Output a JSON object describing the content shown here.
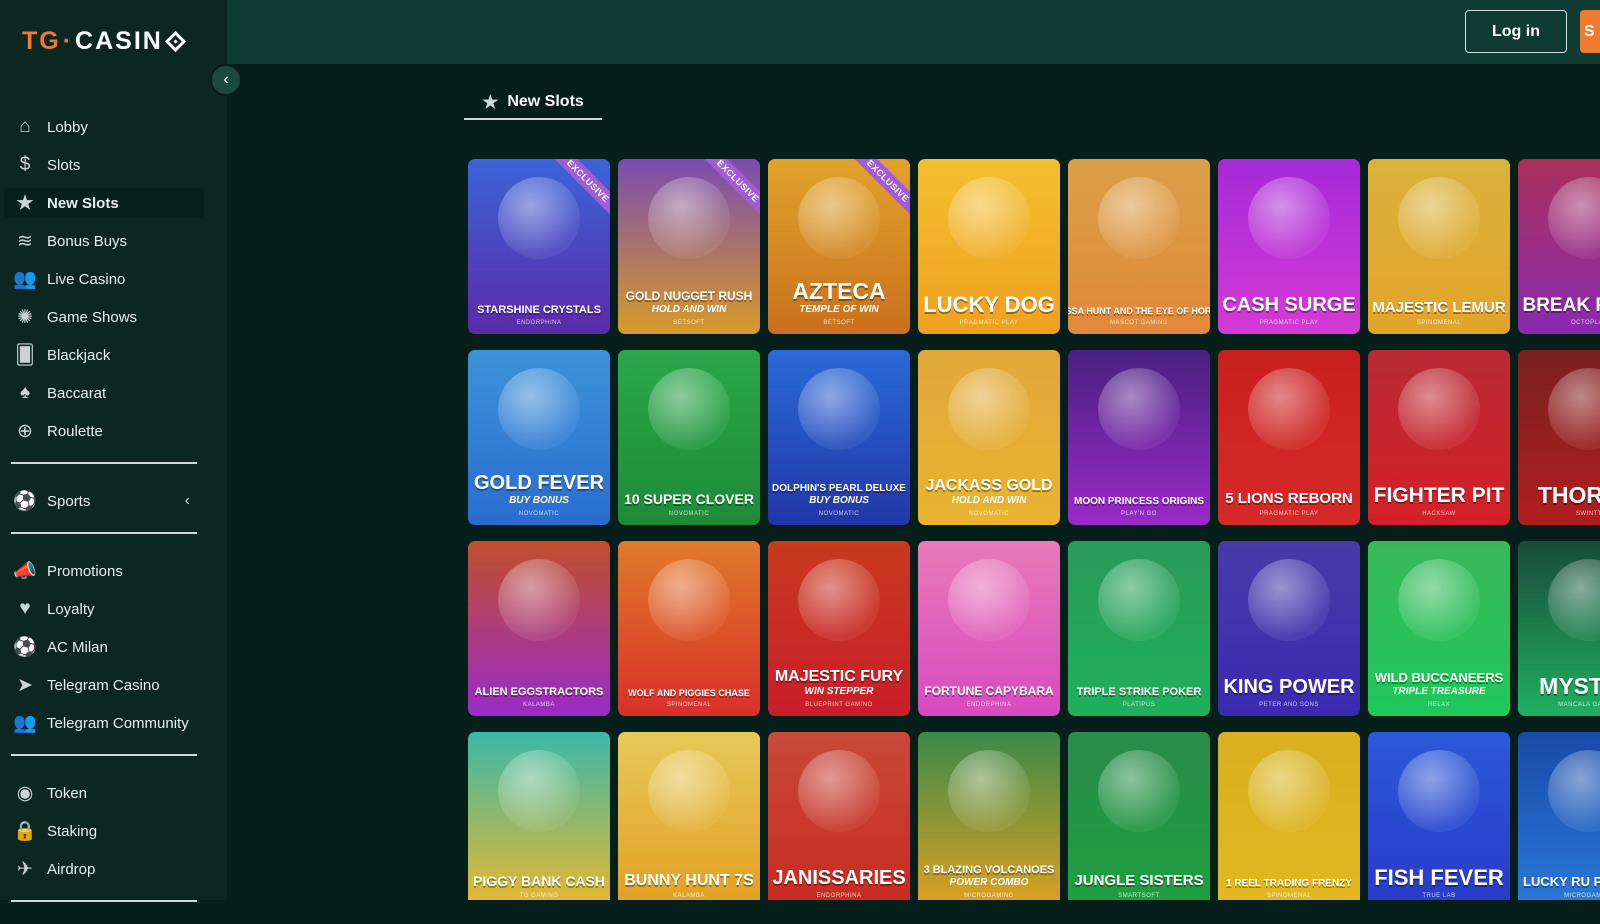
{
  "logo": {
    "tg": "TG",
    "dot": "·",
    "casino": "CASIN"
  },
  "header": {
    "login": "Log in",
    "signup": "S"
  },
  "sidebar": {
    "group1": [
      {
        "label": "Lobby",
        "icon": "home-icon",
        "glyph": "⌂"
      },
      {
        "label": "Slots",
        "icon": "dollar-coin-icon",
        "glyph": "$"
      },
      {
        "label": "New Slots",
        "icon": "star-icon",
        "glyph": "★",
        "active": true
      },
      {
        "label": "Bonus Buys",
        "icon": "coin-stack-icon",
        "glyph": "≋"
      },
      {
        "label": "Live Casino",
        "icon": "users-icon",
        "glyph": "👥"
      },
      {
        "label": "Game Shows",
        "icon": "wheel-icon",
        "glyph": "✺"
      },
      {
        "label": "Blackjack",
        "icon": "cards-icon",
        "glyph": "🂠"
      },
      {
        "label": "Baccarat",
        "icon": "spade-icon",
        "glyph": "♠"
      },
      {
        "label": "Roulette",
        "icon": "roulette-icon",
        "glyph": "⊕"
      }
    ],
    "sports": {
      "label": "Sports",
      "icon": "soccer-ball-icon",
      "glyph": "⚽"
    },
    "group2": [
      {
        "label": "Promotions",
        "icon": "megaphone-icon",
        "glyph": "📣"
      },
      {
        "label": "Loyalty",
        "icon": "heart-hand-icon",
        "glyph": "♥"
      },
      {
        "label": "AC Milan",
        "icon": "football-icon",
        "glyph": "⚽"
      },
      {
        "label": "Telegram Casino",
        "icon": "telegram-icon",
        "glyph": "➤"
      },
      {
        "label": "Telegram Community",
        "icon": "community-icon",
        "glyph": "👥"
      }
    ],
    "group3": [
      {
        "label": "Token",
        "icon": "token-icon",
        "glyph": "◉"
      },
      {
        "label": "Staking",
        "icon": "lock-icon",
        "glyph": "🔒"
      },
      {
        "label": "Airdrop",
        "icon": "plane-icon",
        "glyph": "✈"
      }
    ]
  },
  "tab": {
    "label": "New Slots"
  },
  "badge": "EXCLUSIVE",
  "games": [
    [
      {
        "title": "STARSHINE CRYSTALS",
        "sub": "",
        "provider": "ENDORPHINA",
        "bg": [
          "#3b64d8",
          "#5b2aa8"
        ],
        "exclusive": true
      },
      {
        "title": "GOLD NUGGET RUSH",
        "sub": "HOLD AND WIN",
        "provider": "BETSOFT",
        "bg": [
          "#7a4bb0",
          "#d79a2a"
        ],
        "exclusive": true
      },
      {
        "title": "AZTECA",
        "sub": "TEMPLE OF WIN",
        "provider": "BETSOFT",
        "bg": [
          "#e0a32a",
          "#c9701d"
        ],
        "exclusive": true
      },
      {
        "title": "LUCKY DOG",
        "sub": "",
        "provider": "PRAGMATIC PLAY",
        "bg": [
          "#f2c030",
          "#f0a020"
        ],
        "exclusive": false
      },
      {
        "title": "TESSA HUNT AND THE EYE OF HORUS",
        "sub": "",
        "provider": "MASCOT GAMING",
        "bg": [
          "#d9a048",
          "#e2883a"
        ],
        "exclusive": false
      },
      {
        "title": "CASH SURGE",
        "sub": "",
        "provider": "PRAGMATIC PLAY",
        "bg": [
          "#a52ad8",
          "#d43ad4"
        ],
        "exclusive": false
      },
      {
        "title": "MAJESTIC LEMUR",
        "sub": "",
        "provider": "SPINOMENAL",
        "bg": [
          "#d9b23a",
          "#e3a42a"
        ],
        "exclusive": false
      },
      {
        "title": "BREAK PIGGY",
        "sub": "",
        "provider": "OCTOPLAY",
        "bg": [
          "#a8305a",
          "#8a2ab0"
        ],
        "exclusive": false
      }
    ],
    [
      {
        "title": "GOLD FEVER",
        "sub": "BUY BONUS",
        "provider": "NOVOMATIC",
        "bg": [
          "#3c93d8",
          "#2a6cd0"
        ],
        "exclusive": false
      },
      {
        "title": "10 SUPER CLOVER",
        "sub": "",
        "provider": "NOVOMATIC",
        "bg": [
          "#2aa84a",
          "#1e8a38"
        ],
        "exclusive": false
      },
      {
        "title": "DOLPHIN'S PEARL DELUXE",
        "sub": "BUY BONUS",
        "provider": "NOVOMATIC",
        "bg": [
          "#2a6ad8",
          "#2236a8"
        ],
        "exclusive": false
      },
      {
        "title": "JACKASS GOLD",
        "sub": "HOLD AND WIN",
        "provider": "NOVOMATIC",
        "bg": [
          "#e0a83a",
          "#e8b430"
        ],
        "exclusive": false
      },
      {
        "title": "MOON PRINCESS ORIGINS",
        "sub": "",
        "provider": "PLAY'N GO",
        "bg": [
          "#4a2080",
          "#9a2ac8"
        ],
        "exclusive": false
      },
      {
        "title": "5 LIONS REBORN",
        "sub": "",
        "provider": "PRAGMATIC PLAY",
        "bg": [
          "#c8201e",
          "#d62a2a"
        ],
        "exclusive": false
      },
      {
        "title": "FIGHTER PIT",
        "sub": "",
        "provider": "HACKSAW",
        "bg": [
          "#b82a34",
          "#d42028"
        ],
        "exclusive": false
      },
      {
        "title": "THOR VS",
        "sub": "",
        "provider": "SWINTT",
        "bg": [
          "#7a2020",
          "#b01e1e"
        ],
        "exclusive": false
      }
    ],
    [
      {
        "title": "ALIEN EGGSTRACTORS",
        "sub": "",
        "provider": "KALAMBA",
        "bg": [
          "#c0502a",
          "#9a2ac8"
        ],
        "exclusive": false
      },
      {
        "title": "WOLF AND PIGGIES CHASE",
        "sub": "",
        "provider": "SPINOMENAL",
        "bg": [
          "#e07a2a",
          "#d8302a"
        ],
        "exclusive": false
      },
      {
        "title": "MAJESTIC FURY",
        "sub": "WIN STEPPER",
        "provider": "BLUEPRINT GAMING",
        "bg": [
          "#c83a1e",
          "#c81e2a"
        ],
        "exclusive": false
      },
      {
        "title": "FORTUNE CAPYBARA",
        "sub": "",
        "provider": "ENDORPHINA",
        "bg": [
          "#e87ab8",
          "#d84ac0"
        ],
        "exclusive": false
      },
      {
        "title": "TRIPLE STRIKE POKER",
        "sub": "",
        "provider": "PLATIPUS",
        "bg": [
          "#2a9a5a",
          "#1eb05a"
        ],
        "exclusive": false
      },
      {
        "title": "KING POWER",
        "sub": "",
        "provider": "PETER AND SONS",
        "bg": [
          "#4a3aa8",
          "#3a2ab0"
        ],
        "exclusive": false
      },
      {
        "title": "WILD BUCCANEERS",
        "sub": "TRIPLE TREASURE",
        "provider": "RELAX",
        "bg": [
          "#3ab85a",
          "#1ec85a"
        ],
        "exclusive": false
      },
      {
        "title": "MYSTIC I",
        "sub": "",
        "provider": "MANCALA GAMING",
        "bg": [
          "#1a4a3a",
          "#20b060"
        ],
        "exclusive": false
      }
    ],
    [
      {
        "title": "PIGGY BANK CASH",
        "sub": "",
        "provider": "TG GAMING",
        "bg": [
          "#3ab8a8",
          "#e8b830"
        ],
        "exclusive": false
      },
      {
        "title": "BUNNY HUNT 7S",
        "sub": "",
        "provider": "KALAMBA",
        "bg": [
          "#e8c85a",
          "#e0a020"
        ],
        "exclusive": false
      },
      {
        "title": "JANISSARIES",
        "sub": "",
        "provider": "ENDORPHINA",
        "bg": [
          "#c84a3a",
          "#c82a20"
        ],
        "exclusive": false
      },
      {
        "title": "3 BLAZING VOLCANOES",
        "sub": "POWER COMBO",
        "provider": "MICROGAMING",
        "bg": [
          "#3a8a4a",
          "#e0a020"
        ],
        "exclusive": false
      },
      {
        "title": "JUNGLE SISTERS",
        "sub": "",
        "provider": "SMARTSOFT",
        "bg": [
          "#2a8a4a",
          "#1ea040"
        ],
        "exclusive": false
      },
      {
        "title": "1 REEL TRADING FRENZY",
        "sub": "",
        "provider": "SPINOMENAL",
        "bg": [
          "#d8b020",
          "#e0b820"
        ],
        "exclusive": false
      },
      {
        "title": "FISH FEVER",
        "sub": "",
        "provider": "TRUE LAB",
        "bg": [
          "#2a5ad8",
          "#2a3ac8"
        ],
        "exclusive": false
      },
      {
        "title": "LUCKY RU POWER S",
        "sub": "",
        "provider": "MICROGAMING",
        "bg": [
          "#1a4aa8",
          "#2a7ad8"
        ],
        "exclusive": false
      }
    ]
  ]
}
